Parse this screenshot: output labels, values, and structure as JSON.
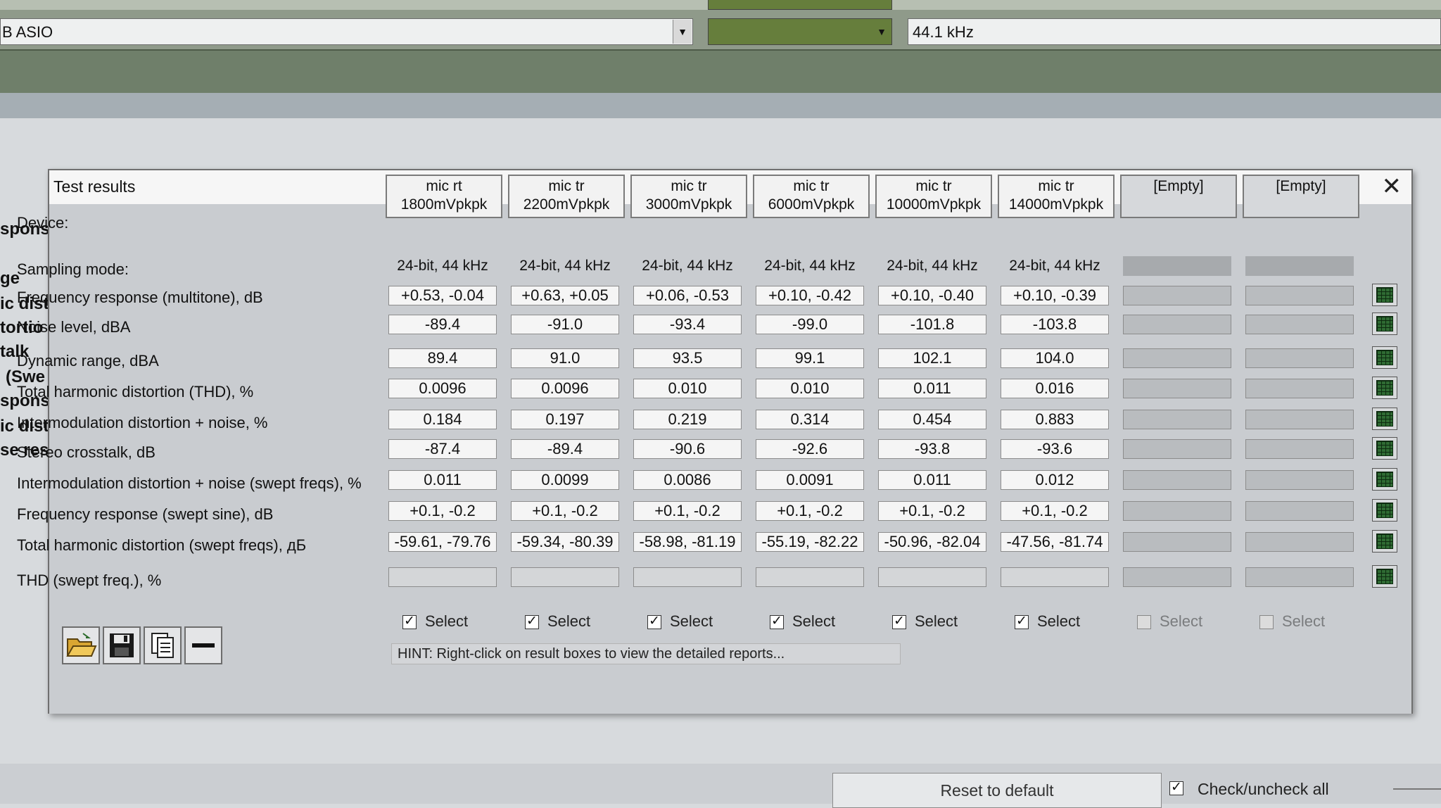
{
  "background": {
    "driver_combo": "B ASIO",
    "sample_rate": "44.1 kHz",
    "side_labels": [
      "spons",
      "ge",
      "ic dist",
      "tortio",
      "talk",
      "(Swe",
      "spons",
      "ic dist",
      "se res"
    ],
    "reset_button": "Reset to default",
    "check_all_label": "Check/uncheck all"
  },
  "dialog": {
    "title": "Test results",
    "close_glyph": "✕",
    "device_label": "Device:",
    "sampling_label": "Sampling mode:",
    "devices": [
      {
        "line1": "mic rt",
        "line2": "1800mVpkpk",
        "sampling": "24-bit, 44 kHz",
        "selected": true
      },
      {
        "line1": "mic tr",
        "line2": "2200mVpkpk",
        "sampling": "24-bit, 44 kHz",
        "selected": true
      },
      {
        "line1": "mic tr",
        "line2": "3000mVpkpk",
        "sampling": "24-bit, 44 kHz",
        "selected": true
      },
      {
        "line1": "mic tr",
        "line2": "6000mVpkpk",
        "sampling": "24-bit, 44 kHz",
        "selected": true
      },
      {
        "line1": "mic tr",
        "line2": "10000mVpkpk",
        "sampling": "24-bit, 44 kHz",
        "selected": true
      },
      {
        "line1": "mic tr",
        "line2": "14000mVpkpk",
        "sampling": "24-bit, 44 kHz",
        "selected": true
      },
      {
        "line1": "[Empty]",
        "line2": "",
        "sampling": "",
        "selected": false
      },
      {
        "line1": "[Empty]",
        "line2": "",
        "sampling": "",
        "selected": false
      }
    ],
    "rows": [
      {
        "label": "Frequency response (multitone), dB",
        "values": [
          "+0.53, -0.04",
          "+0.63, +0.05",
          "+0.06, -0.53",
          "+0.10, -0.42",
          "+0.10, -0.40",
          "+0.10, -0.39"
        ]
      },
      {
        "label": "Noise level, dBA",
        "values": [
          "-89.4",
          "-91.0",
          "-93.4",
          "-99.0",
          "-101.8",
          "-103.8"
        ]
      },
      {
        "label": "Dynamic range, dBA",
        "values": [
          "89.4",
          "91.0",
          "93.5",
          "99.1",
          "102.1",
          "104.0"
        ]
      },
      {
        "label": "Total harmonic distortion (THD), %",
        "values": [
          "0.0096",
          "0.0096",
          "0.010",
          "0.010",
          "0.011",
          "0.016"
        ]
      },
      {
        "label": "Intermodulation distortion + noise, %",
        "values": [
          "0.184",
          "0.197",
          "0.219",
          "0.314",
          "0.454",
          "0.883"
        ]
      },
      {
        "label": "Stereo crosstalk, dB",
        "values": [
          "-87.4",
          "-89.4",
          "-90.6",
          "-92.6",
          "-93.8",
          "-93.6"
        ]
      },
      {
        "label": "Intermodulation distortion + noise (swept freqs), %",
        "values": [
          "0.011",
          "0.0099",
          "0.0086",
          "0.0091",
          "0.011",
          "0.012"
        ]
      },
      {
        "label": "Frequency response (swept sine), dB",
        "values": [
          "+0.1, -0.2",
          "+0.1, -0.2",
          "+0.1, -0.2",
          "+0.1, -0.2",
          "+0.1, -0.2",
          "+0.1, -0.2"
        ]
      },
      {
        "label": "Total harmonic distortion (swept freqs), дБ",
        "values": [
          "-59.61, -79.76",
          "-59.34, -80.39",
          "-58.98, -81.19",
          "-55.19, -82.22",
          "-50.96, -82.04",
          "-47.56, -81.74"
        ]
      },
      {
        "label": "THD (swept freq.), %",
        "values": [
          "",
          "",
          "",
          "",
          "",
          ""
        ]
      }
    ],
    "select_label": "Select",
    "hint": "HINT: Right-click on result boxes to view the detailed reports...",
    "tools": [
      "open-folder-icon",
      "save-icon",
      "copy-report-icon",
      "minus-icon"
    ]
  }
}
